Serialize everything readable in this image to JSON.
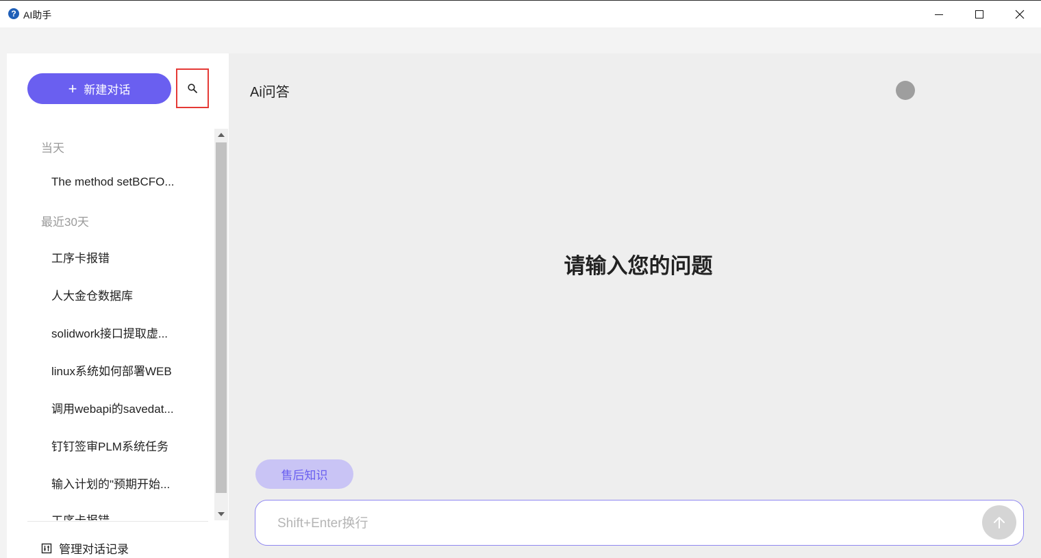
{
  "window": {
    "title": "AI助手",
    "app_icon": "?"
  },
  "sidebar": {
    "new_chat_label": "新建对话",
    "new_chat_icon": "plus-icon",
    "search_icon": "search-icon",
    "groups": [
      {
        "label": "当天",
        "items": [
          "The method setBCFO..."
        ]
      },
      {
        "label": "最近30天",
        "items": [
          "工序卡报错",
          "人大金仓数据库",
          "solidwork接口提取虚...",
          "linux系统如何部署WEB",
          "调用webapi的savedat...",
          "钉钉签审PLM系统任务",
          "输入计划的\"预期开始...",
          "工序卡报错"
        ]
      }
    ],
    "manage_label": "管理对话记录"
  },
  "main": {
    "title": "Ai问答",
    "welcome": "请输入您的问题",
    "kb_chip": "售后知识",
    "input_placeholder": "Shift+Enter换行",
    "input_value": ""
  },
  "colors": {
    "accent": "#6a5ff0",
    "chip_bg": "#c9c4f5",
    "main_bg": "#eeeeee",
    "highlight": "#e53935"
  }
}
